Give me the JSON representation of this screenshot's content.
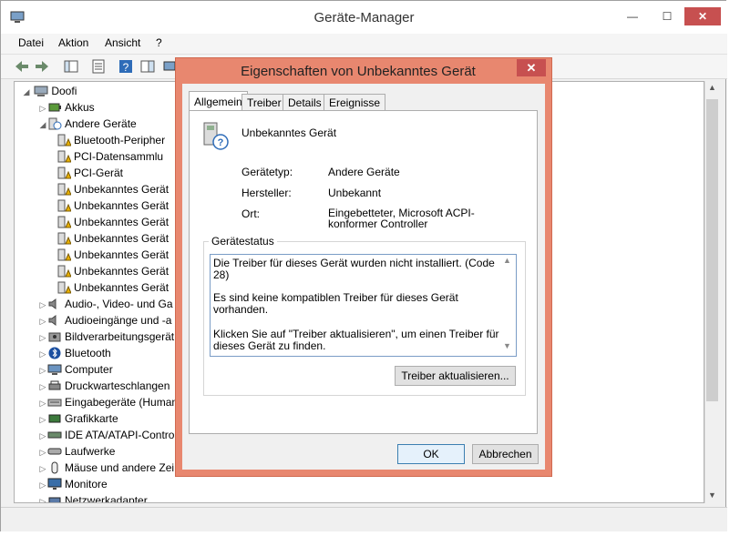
{
  "main_window": {
    "title": "Geräte-Manager",
    "menu": [
      "Datei",
      "Aktion",
      "Ansicht",
      "?"
    ],
    "controls": {
      "minimize": "—",
      "maximize": "☐",
      "close": "✕"
    }
  },
  "tree": {
    "root": "Doofi",
    "items": [
      {
        "label": "Akkus",
        "level": 1,
        "arrow": "▷",
        "icon": "battery-icon"
      },
      {
        "label": "Andere Geräte",
        "level": 1,
        "arrow": "◢",
        "icon": "unknown-devices-icon"
      },
      {
        "label": "Bluetooth-Peripher",
        "level": 2,
        "arrow": "",
        "icon": "warning-device-icon"
      },
      {
        "label": "PCI-Datensammlu",
        "level": 2,
        "arrow": "",
        "icon": "warning-device-icon"
      },
      {
        "label": "PCI-Gerät",
        "level": 2,
        "arrow": "",
        "icon": "warning-device-icon"
      },
      {
        "label": "Unbekanntes Gerät",
        "level": 2,
        "arrow": "",
        "icon": "warning-device-icon"
      },
      {
        "label": "Unbekanntes Gerät",
        "level": 2,
        "arrow": "",
        "icon": "warning-device-icon"
      },
      {
        "label": "Unbekanntes Gerät",
        "level": 2,
        "arrow": "",
        "icon": "warning-device-icon"
      },
      {
        "label": "Unbekanntes Gerät",
        "level": 2,
        "arrow": "",
        "icon": "warning-device-icon"
      },
      {
        "label": "Unbekanntes Gerät",
        "level": 2,
        "arrow": "",
        "icon": "warning-device-icon"
      },
      {
        "label": "Unbekanntes Gerät",
        "level": 2,
        "arrow": "",
        "icon": "warning-device-icon"
      },
      {
        "label": "Unbekanntes Gerät",
        "level": 2,
        "arrow": "",
        "icon": "warning-device-icon"
      },
      {
        "label": "Audio-, Video- und Ga",
        "level": 1,
        "arrow": "▷",
        "icon": "speaker-icon"
      },
      {
        "label": "Audioeingänge und -a",
        "level": 1,
        "arrow": "▷",
        "icon": "speaker-icon"
      },
      {
        "label": "Bildverarbeitungsgerät",
        "level": 1,
        "arrow": "▷",
        "icon": "camera-icon"
      },
      {
        "label": "Bluetooth",
        "level": 1,
        "arrow": "▷",
        "icon": "bluetooth-icon"
      },
      {
        "label": "Computer",
        "level": 1,
        "arrow": "▷",
        "icon": "computer-icon"
      },
      {
        "label": "Druckwarteschlangen",
        "level": 1,
        "arrow": "▷",
        "icon": "printer-icon"
      },
      {
        "label": "Eingabegeräte (Human",
        "level": 1,
        "arrow": "▷",
        "icon": "input-device-icon"
      },
      {
        "label": "Grafikkarte",
        "level": 1,
        "arrow": "▷",
        "icon": "display-adapter-icon"
      },
      {
        "label": "IDE ATA/ATAPI-Contro",
        "level": 1,
        "arrow": "▷",
        "icon": "ide-controller-icon"
      },
      {
        "label": "Laufwerke",
        "level": 1,
        "arrow": "▷",
        "icon": "disk-drive-icon"
      },
      {
        "label": "Mäuse und andere Zei",
        "level": 1,
        "arrow": "▷",
        "icon": "mouse-icon"
      },
      {
        "label": "Monitore",
        "level": 1,
        "arrow": "▷",
        "icon": "monitor-icon"
      },
      {
        "label": "Netzwerkadapter",
        "level": 1,
        "arrow": "▷",
        "icon": "network-adapter-icon"
      }
    ]
  },
  "dialog": {
    "title": "Eigenschaften von Unbekanntes Gerät",
    "close": "✕",
    "tabs": [
      "Allgemein",
      "Treiber",
      "Details",
      "Ereignisse"
    ],
    "active_tab": "Allgemein",
    "device_name": "Unbekanntes Gerät",
    "props": [
      {
        "label": "Gerätetyp:",
        "value": "Andere Geräte"
      },
      {
        "label": "Hersteller:",
        "value": "Unbekannt"
      },
      {
        "label": "Ort:",
        "value": "Eingebetteter, Microsoft ACPI-konformer Controller"
      }
    ],
    "status_group": "Gerätestatus",
    "status_lines": [
      "Die Treiber für dieses Gerät wurden nicht installiert. (Code 28)",
      "Es sind keine kompatiblen Treiber für dieses Gerät vorhanden.",
      "Klicken Sie auf \"Treiber aktualisieren\", um einen Treiber für dieses Gerät zu finden."
    ],
    "update_button": "Treiber aktualisieren...",
    "ok_button": "OK",
    "cancel_button": "Abbrechen"
  },
  "colors": {
    "dialog_frame": "#e8876f",
    "close_button": "#c75050",
    "accent": "#3c7fb1"
  }
}
